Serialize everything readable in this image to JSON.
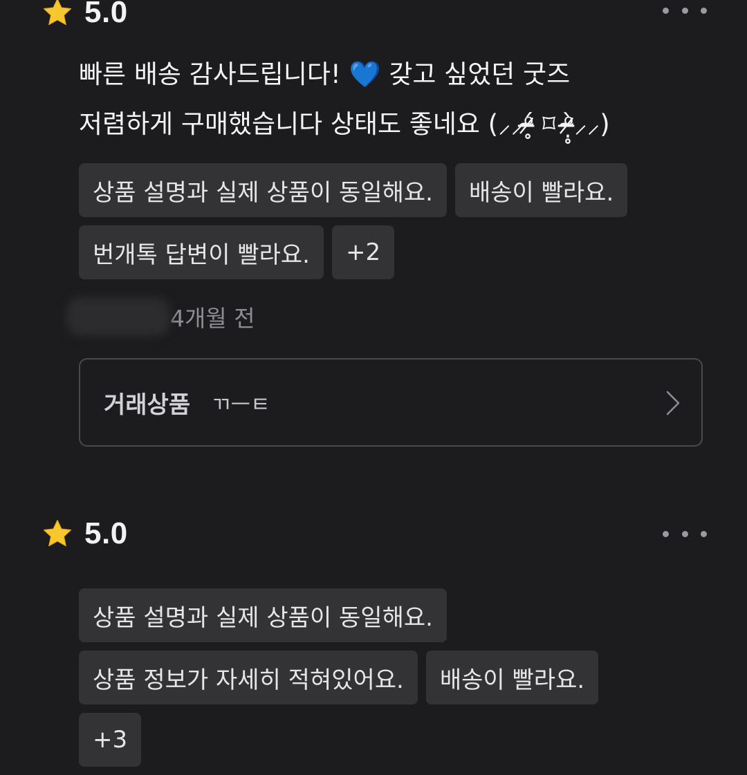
{
  "reviews": [
    {
      "rating": "5.0",
      "text_lines": [
        "빠른 배송 감사드립니다! 💙 갖고 싶었던 굿즈",
        "저렴하게 구매했습니다 상태도 좋네요 (⸝⸝ᵒ̴̶̷̥́ ⌑ ᵒ̴̶̷̣̥̀⸝⸝)"
      ],
      "tags": [
        "상품 설명과 실제 상품이 동일해요.",
        "배송이 빨라요.",
        "번개톡 답변이 빨라요.",
        "+2"
      ],
      "time_ago": "4개월 전",
      "product_card": {
        "label": "거래상품",
        "name": "ㄲㅡㅌ"
      }
    },
    {
      "rating": "5.0",
      "tags": [
        "상품 설명과 실제 상품이 동일해요.",
        "상품 정보가 자세히 적혀있어요.",
        "배송이 빨라요.",
        "+3"
      ]
    }
  ],
  "icons": {
    "star": "star-icon",
    "more": "more-dots-icon",
    "chevron": "chevron-right-icon"
  },
  "colors": {
    "background": "#1c1c1e",
    "tag_background": "#333336",
    "star": "#f7c72e",
    "muted_text": "#8e8e92"
  }
}
